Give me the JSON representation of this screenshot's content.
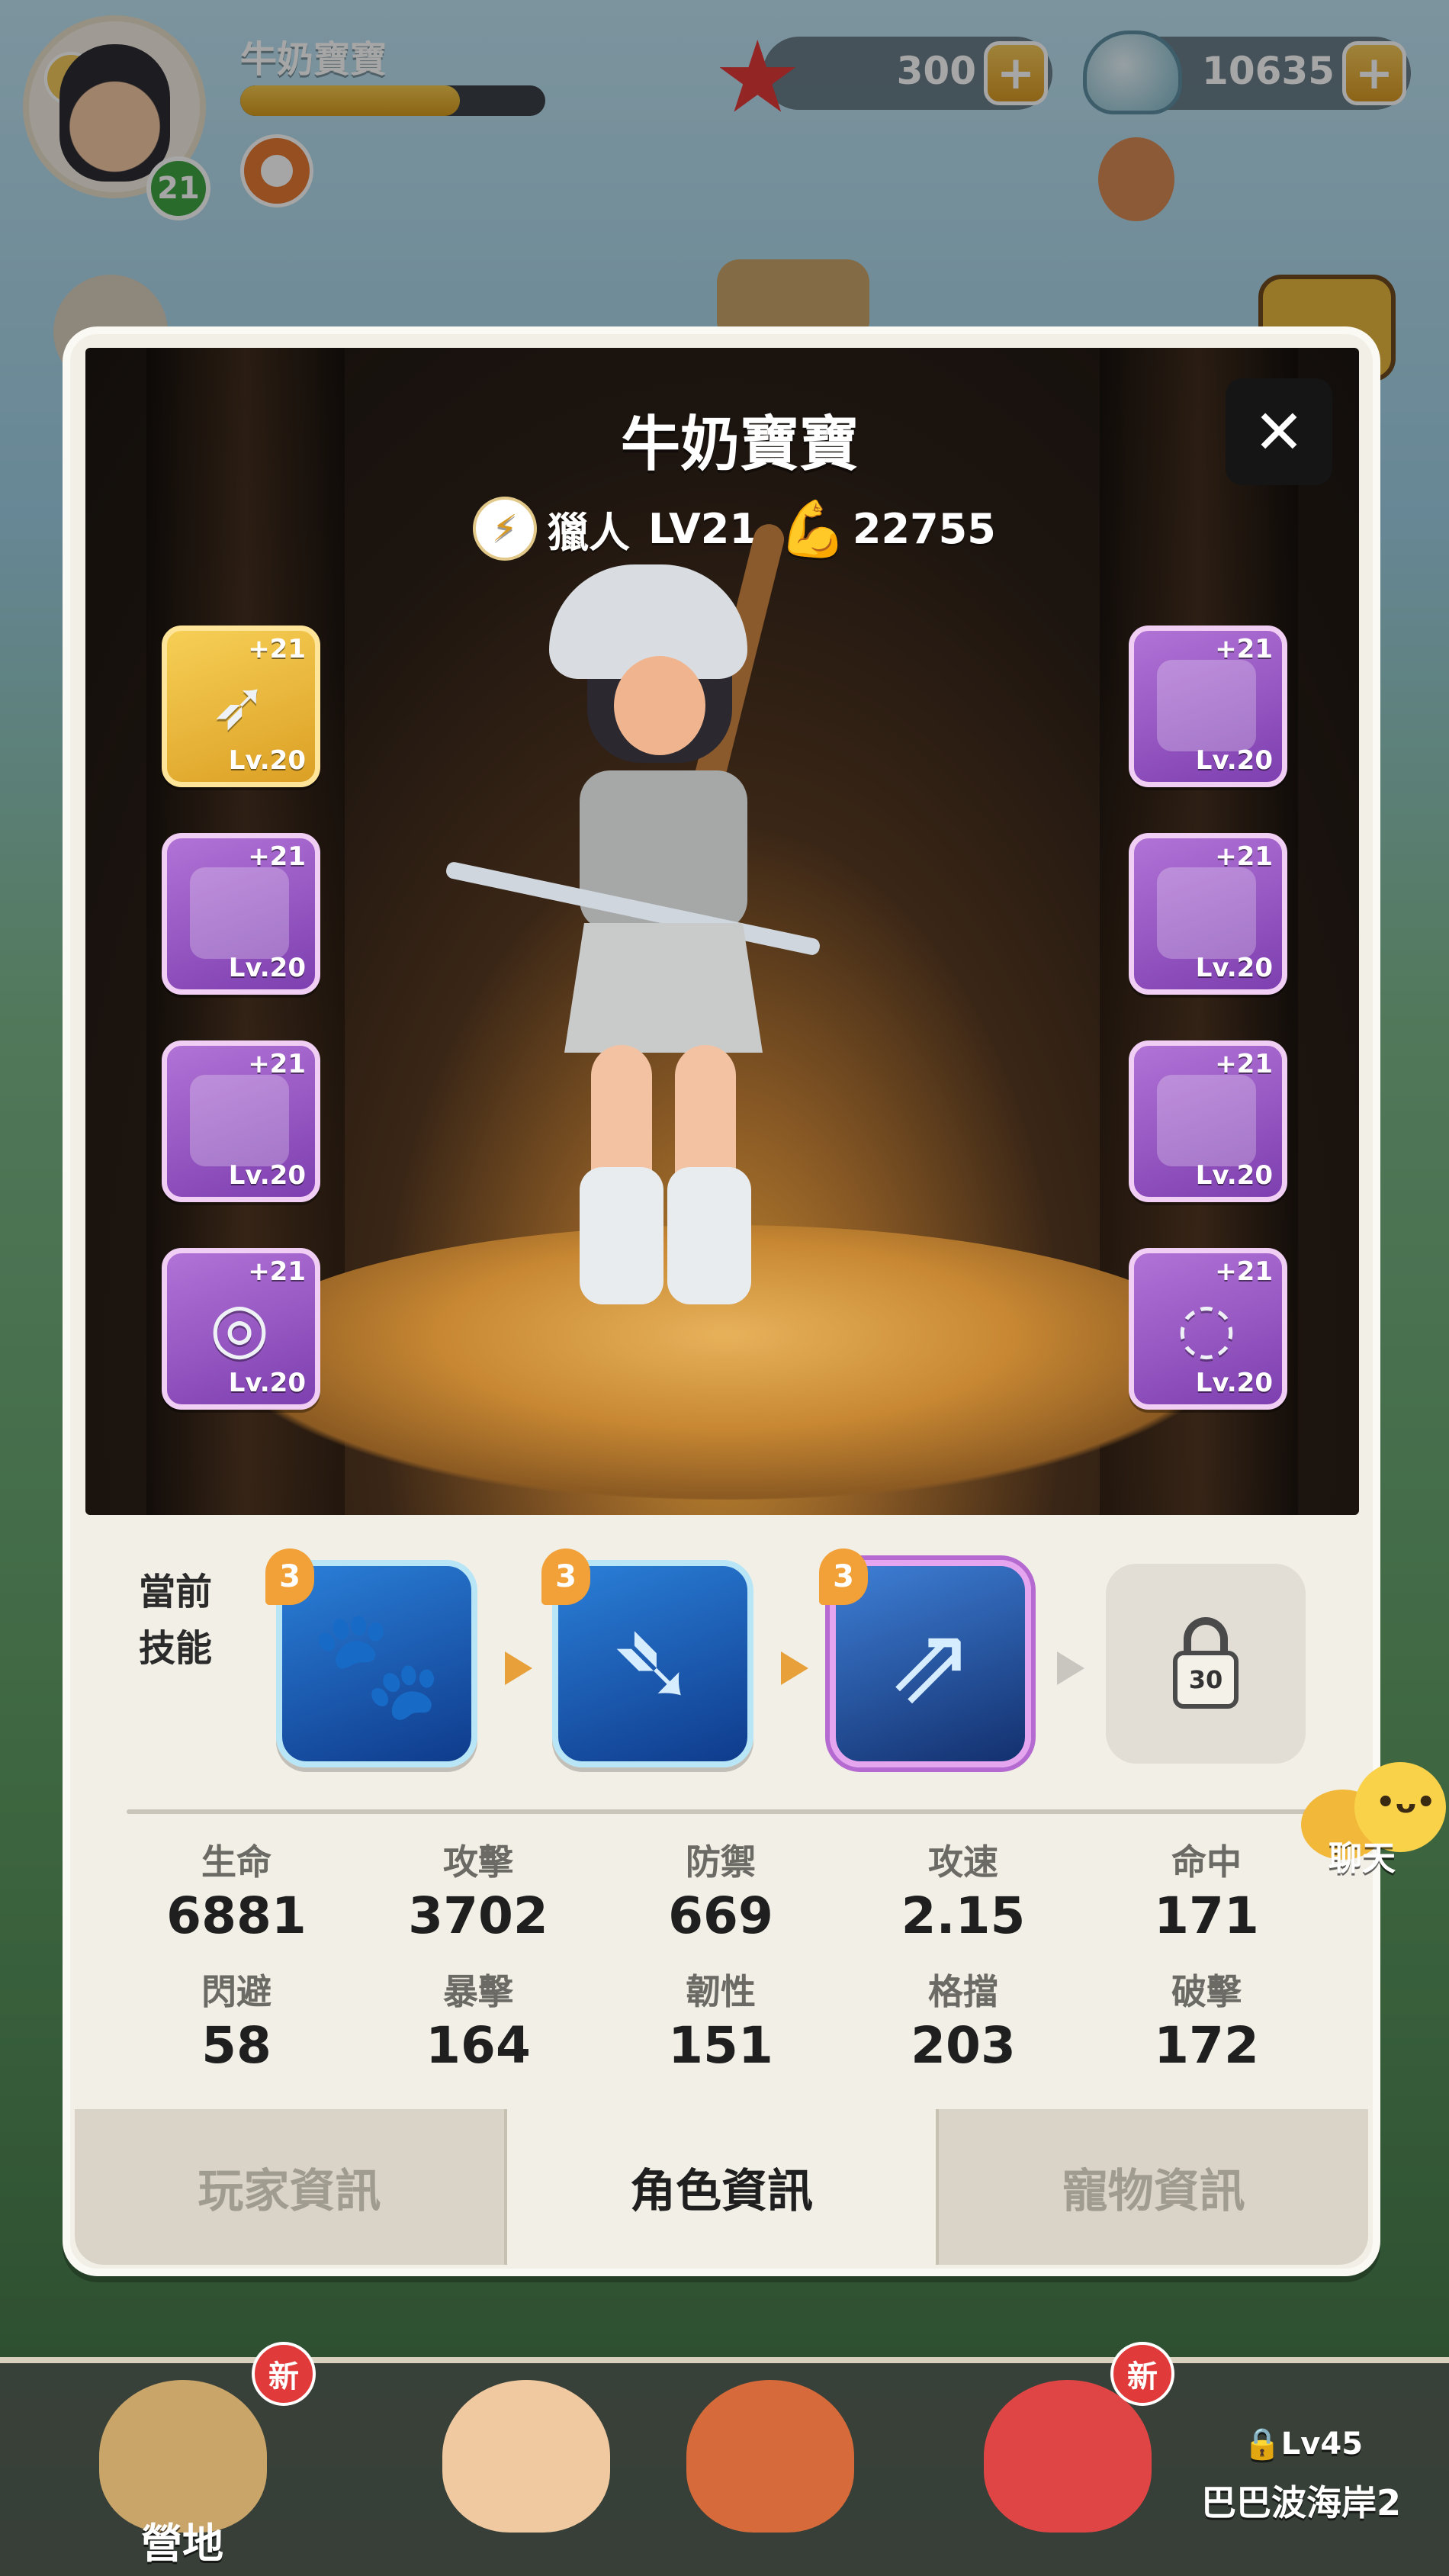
{
  "hud": {
    "player_name": "牛奶寶寶",
    "player_level": "21",
    "xp_progress": 0.72,
    "currency_star": "300",
    "currency_shell": "10635",
    "plus": "+"
  },
  "panel": {
    "char_name": "牛奶寶寶",
    "close": "✕",
    "class_name": "獵人",
    "class_level": "LV21",
    "power": "22755",
    "equipment_left": [
      {
        "plus": "+21",
        "level": "Lv.20",
        "item": "bow",
        "rarity": "gold"
      },
      {
        "plus": "+21",
        "level": "Lv.20",
        "item": "wolf-helmet",
        "rarity": "purple"
      },
      {
        "plus": "+21",
        "level": "Lv.20",
        "item": "armguard",
        "rarity": "purple"
      },
      {
        "plus": "+21",
        "level": "Lv.20",
        "item": "ring",
        "rarity": "purple"
      }
    ],
    "equipment_right": [
      {
        "plus": "+21",
        "level": "Lv.20",
        "item": "gauntlet",
        "rarity": "purple"
      },
      {
        "plus": "+21",
        "level": "Lv.20",
        "item": "armor",
        "rarity": "purple"
      },
      {
        "plus": "+21",
        "level": "Lv.20",
        "item": "boots",
        "rarity": "purple"
      },
      {
        "plus": "+21",
        "level": "Lv.20",
        "item": "necklace",
        "rarity": "purple"
      }
    ],
    "skills_label": "當前\n技能",
    "skills": [
      {
        "num": "3",
        "icon": "pet-skill-icon"
      },
      {
        "num": "3",
        "icon": "arrow-rain-icon"
      },
      {
        "num": "3",
        "icon": "twin-arrow-icon"
      }
    ],
    "locked_level": "30",
    "stats_row1": [
      {
        "label": "生命",
        "value": "6881"
      },
      {
        "label": "攻擊",
        "value": "3702"
      },
      {
        "label": "防禦",
        "value": "669"
      },
      {
        "label": "攻速",
        "value": "2.15"
      },
      {
        "label": "命中",
        "value": "171"
      }
    ],
    "stats_row2": [
      {
        "label": "閃避",
        "value": "58"
      },
      {
        "label": "暴擊",
        "value": "164"
      },
      {
        "label": "韌性",
        "value": "151"
      },
      {
        "label": "格擋",
        "value": "203"
      },
      {
        "label": "破擊",
        "value": "172"
      }
    ],
    "tabs": [
      "玩家資訊",
      "角色資訊",
      "寵物資訊"
    ]
  },
  "chat": {
    "label": "聊天",
    "face": "•ᴗ•"
  },
  "bottom": {
    "camp_label": "營地",
    "new_badge": "新",
    "map_level": "🔒Lv45",
    "map_name": "巴巴波海岸2"
  },
  "colors": {
    "accent_gold": "#f4c94f",
    "epic_purple": "#9a52c5",
    "skill_blue": "#2a7fd8",
    "badge_red": "#e03a3a"
  }
}
